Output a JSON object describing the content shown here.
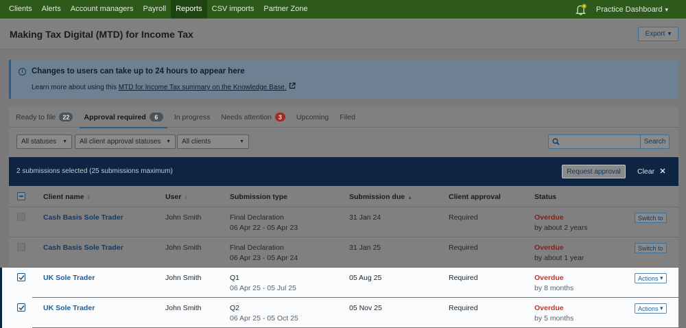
{
  "nav": {
    "items": [
      "Clients",
      "Alerts",
      "Account managers",
      "Payroll",
      "Reports",
      "CSV imports",
      "Partner Zone"
    ],
    "active": "Reports",
    "practice_label": "Practice Dashboard",
    "bell_icon": "bell-icon"
  },
  "header": {
    "title": "Making Tax Digital (MTD) for Income Tax",
    "export_label": "Export"
  },
  "banner": {
    "title": "Changes to users can take up to 24 hours to appear here",
    "text_prefix": "Learn more about using this ",
    "link_text": "MTD for Income Tax summary on the Knowledge Base.",
    "icon": "info-icon"
  },
  "tabs": [
    {
      "label": "Ready to file",
      "badge": "22"
    },
    {
      "label": "Approval required",
      "badge": "6",
      "active": true
    },
    {
      "label": "In progress",
      "badge": ""
    },
    {
      "label": "Needs attention",
      "badge": "3",
      "badge_color": "#a12c25"
    },
    {
      "label": "Upcoming",
      "badge": ""
    },
    {
      "label": "Filed",
      "badge": ""
    }
  ],
  "filters": {
    "status": "All statuses",
    "client_approval": "All client approval statuses",
    "clients": "All clients",
    "search_placeholder": "",
    "search_button": "Search"
  },
  "selection": {
    "text": "2 submissions selected (25 submissions maximum)",
    "request_label": "Request approval",
    "clear_label": "Clear"
  },
  "table": {
    "headers": {
      "client_name": "Client name",
      "user": "User",
      "submission_type": "Submission type",
      "submission_due": "Submission due",
      "client_approval": "Client approval",
      "status": "Status"
    },
    "rows": [
      {
        "client": "Cash Basis Sole Trader",
        "user": "John Smith",
        "type": "Final Declaration",
        "period": "06 Apr 22 - 05 Apr 23",
        "due": "31 Jan 24",
        "approval": "Required",
        "status": "Overdue",
        "status_sub": "by about 2 years",
        "action": "Switch to",
        "selected": false
      },
      {
        "client": "Cash Basis Sole Trader",
        "user": "John Smith",
        "type": "Final Declaration",
        "period": "06 Apr 23 - 05 Apr 24",
        "due": "31 Jan 25",
        "approval": "Required",
        "status": "Overdue",
        "status_sub": "by about 1 year",
        "action": "Switch to",
        "selected": false
      },
      {
        "client": "UK Sole Trader",
        "user": "John Smith",
        "type": "Q1",
        "period": "06 Apr 25 - 05 Jul 25",
        "due": "05 Aug 25",
        "approval": "Required",
        "status": "Overdue",
        "status_sub": "by 8 months",
        "action": "Actions",
        "selected": true
      },
      {
        "client": "UK Sole Trader",
        "user": "John Smith",
        "type": "Q2",
        "period": "06 Apr 25 - 05 Oct 25",
        "due": "05 Nov 25",
        "approval": "Required",
        "status": "Overdue",
        "status_sub": "by 5 months",
        "action": "Actions",
        "selected": true
      }
    ]
  },
  "colors": {
    "nav_bg": "#2d5a1a",
    "selection_bar": "#0d2443",
    "overdue": "#c0392b",
    "link": "#1c5d9e"
  }
}
